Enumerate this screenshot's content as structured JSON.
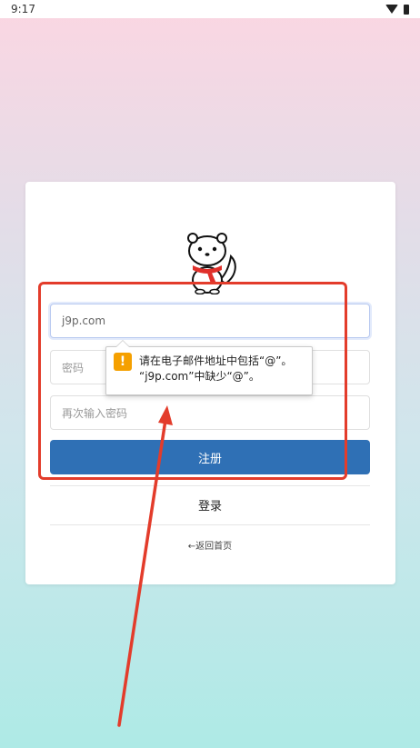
{
  "status_bar": {
    "time": "9:17",
    "icons": [
      "wifi-icon",
      "battery-icon"
    ]
  },
  "form": {
    "email_value": "j9p.com",
    "password_placeholder": "密码",
    "confirm_password_placeholder": "再次输入密码",
    "register_label": "注册",
    "login_label": "登录",
    "back_home_label": "←返回首页"
  },
  "validation_tooltip": {
    "line1": "请在电子邮件地址中包括“@”。",
    "line2": "“j9p.com”中缺少“@”。"
  },
  "colors": {
    "primary_button": "#2f70b5",
    "annotation": "#e33c2b",
    "warning": "#f5a000"
  }
}
